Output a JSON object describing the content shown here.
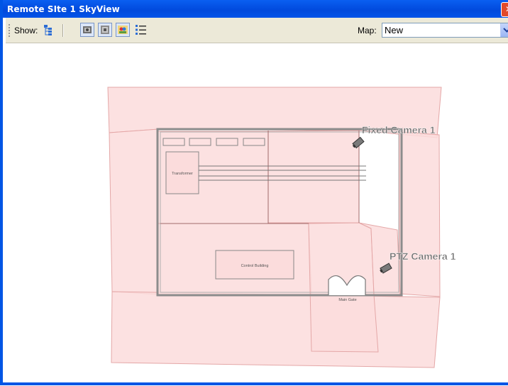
{
  "window": {
    "title": "Remote SIte 1 SkyView",
    "close_glyph": "✕"
  },
  "toolbar": {
    "show_label": "Show:",
    "map_label": "Map:",
    "map_value": "New",
    "icons": [
      "tree-view-icon",
      "camera-view-icon",
      "camera-list-icon",
      "people-icon",
      "list-icon"
    ]
  },
  "map": {
    "rooms": {
      "transformer": "Transformer",
      "control_building": "Control Building",
      "main_gate": "Main Gate"
    },
    "cameras": [
      {
        "name": "Fixed Camera 1"
      },
      {
        "name": "PTZ Camera 1"
      }
    ]
  },
  "colors": {
    "title_bar": "#0149dc",
    "coverage_fill": "#fbdcdc",
    "coverage_stroke": "#e4a7a7",
    "wall": "#8c8c8c"
  }
}
